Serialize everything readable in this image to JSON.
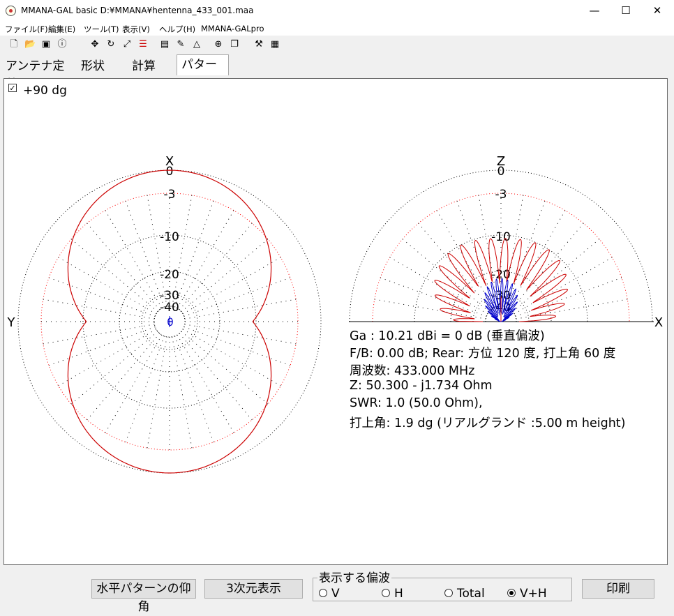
{
  "window": {
    "title": "MMANA-GAL basic  D:¥MMANA¥hentenna_433_001.maa",
    "controls": {
      "minimize": "—",
      "maximize": "☐",
      "close": "✕"
    }
  },
  "menu": [
    "ファイル(F)",
    "編集(E)",
    "ツール(T)",
    "表示(V)",
    "ヘルプ(H)",
    "MMANA-GALpro"
  ],
  "toolbar_icons": [
    "new-file-icon",
    "open-folder-icon",
    "save-icon",
    "info-icon",
    "move-icon",
    "rotate-icon",
    "resize-icon",
    "wires-icon",
    "document-icon",
    "pen-icon",
    "triangle-icon",
    "target-icon",
    "copy-icon",
    "tools-icon",
    "calculator-icon"
  ],
  "tabs": [
    {
      "label": "アンテナ定義",
      "active": false
    },
    {
      "label": "形状",
      "active": false
    },
    {
      "label": "計算",
      "active": false
    },
    {
      "label": "パターン",
      "active": true
    }
  ],
  "checkbox": {
    "label": "+90 dg",
    "checked": true
  },
  "horizontal_plot": {
    "top_label": "X",
    "left_label": "Y",
    "center_label": "θ",
    "ring_labels": [
      "0",
      "-3",
      "-10",
      "-20",
      "-30",
      "-40"
    ]
  },
  "vertical_plot": {
    "top_label": "Z",
    "right_label": "X",
    "ring_labels": [
      "0",
      "-3",
      "-10",
      "-20",
      "-30",
      "-40"
    ]
  },
  "info_lines": [
    "Ga : 10.21 dBi = 0 dB  (垂直偏波)",
    "F/B: 0.00 dB; Rear: 方位 120 度,  打上角 60 度",
    "周波数: 433.000 MHz",
    "Z: 50.300 - j1.734 Ohm",
    "SWR: 1.0 (50.0 Ohm),",
    "打上角: 1.9 dg (リアルグランド  :5.00 m height)"
  ],
  "buttons": {
    "elevation": "水平パターンの仰角",
    "view3d": "3次元表示",
    "print": "印刷"
  },
  "polarization": {
    "group_label": "表示する偏波",
    "options": [
      {
        "label": "V",
        "selected": false
      },
      {
        "label": "H",
        "selected": false
      },
      {
        "label": "Total",
        "selected": false
      },
      {
        "label": "V+H",
        "selected": true
      }
    ]
  },
  "colors": {
    "pattern_red": "#cc0000",
    "pattern_blue": "#0000cc",
    "grid_black": "#000000",
    "minus3_ring": "#ff0000"
  },
  "chart_data": [
    {
      "type": "polar",
      "name_in_ui": "horizontal",
      "rings_db": [
        0,
        -3,
        -10,
        -20,
        -30,
        -40
      ],
      "series": [
        {
          "color": "#cc0000",
          "azimuth_deg": [
            0,
            30,
            60,
            90,
            120,
            150,
            180
          ],
          "gain_db": [
            0,
            -1.3,
            -5,
            -6,
            -5,
            -1.3,
            0
          ]
        }
      ]
    },
    {
      "type": "polar",
      "name_in_ui": "vertical",
      "rings_db": [
        0,
        -3,
        -10,
        -20,
        -30,
        -40
      ],
      "series": [
        {
          "color": "#cc0000",
          "elevation_lobes": 16
        },
        {
          "color": "#0000cc",
          "elevation_lobes": 18
        }
      ]
    }
  ]
}
